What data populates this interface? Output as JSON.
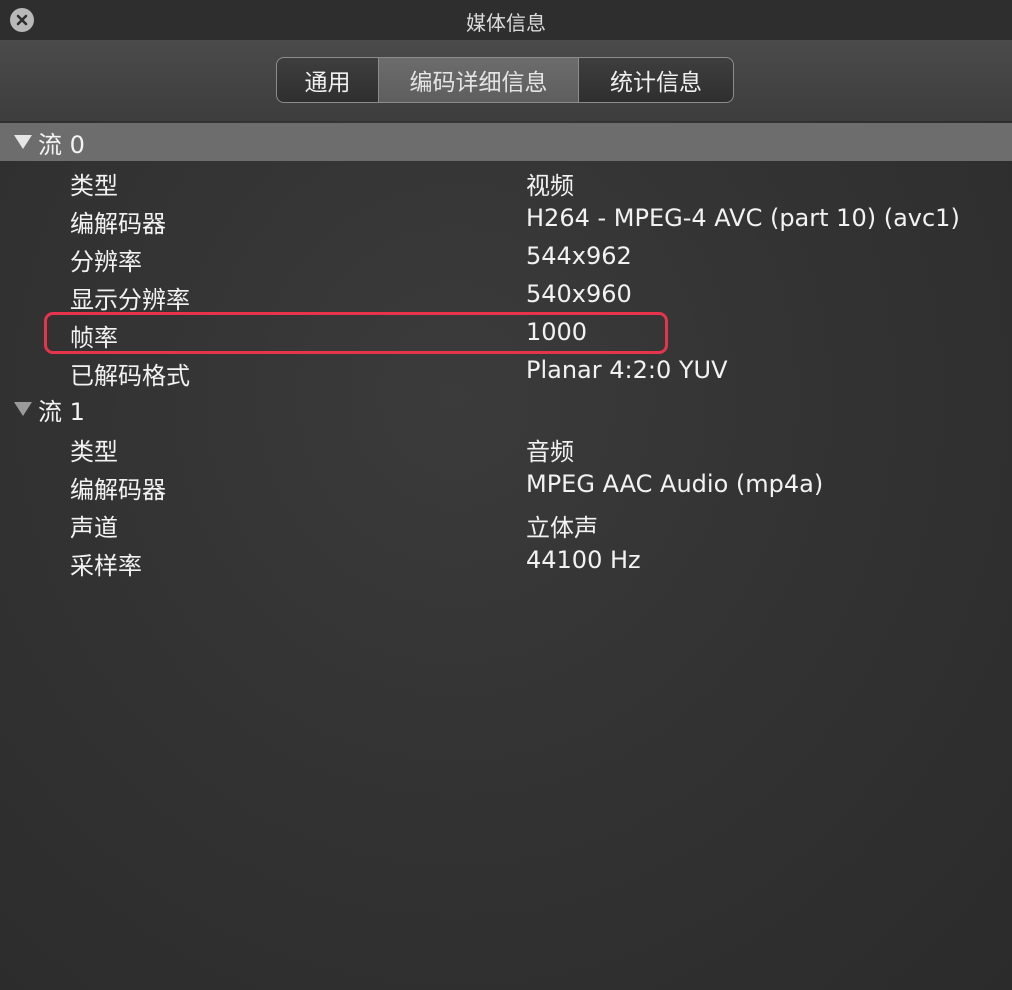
{
  "window": {
    "title": "媒体信息"
  },
  "tabs": [
    {
      "label": "通用"
    },
    {
      "label": "编码详细信息"
    },
    {
      "label": "统计信息"
    }
  ],
  "streams": [
    {
      "label": "流 0",
      "rows": [
        {
          "key": "类型",
          "value": "视频"
        },
        {
          "key": "编解码器",
          "value": "H264 - MPEG-4 AVC (part 10) (avc1)"
        },
        {
          "key": "分辨率",
          "value": "544x962"
        },
        {
          "key": "显示分辨率",
          "value": "540x960"
        },
        {
          "key": "帧率",
          "value": "1000"
        },
        {
          "key": "已解码格式",
          "value": "Planar 4:2:0 YUV"
        }
      ]
    },
    {
      "label": "流 1",
      "rows": [
        {
          "key": "类型",
          "value": "音频"
        },
        {
          "key": "编解码器",
          "value": "MPEG AAC Audio (mp4a)"
        },
        {
          "key": "声道",
          "value": "立体声"
        },
        {
          "key": "采样率",
          "value": "44100 Hz"
        }
      ]
    }
  ],
  "colors": {
    "highlight": "#e5344b",
    "selected_row": "#6d6d6d"
  }
}
